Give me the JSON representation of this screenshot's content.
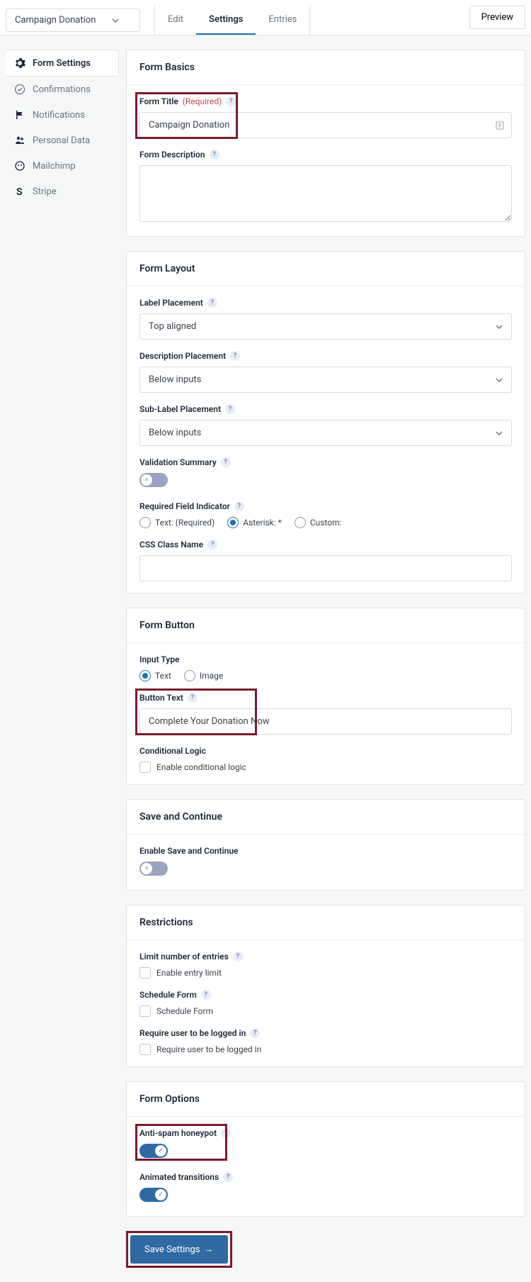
{
  "header": {
    "formSelector": "Campaign Donation",
    "tabs": {
      "edit": "Edit",
      "settings": "Settings",
      "entries": "Entries"
    },
    "preview": "Preview"
  },
  "sidebar": {
    "items": [
      {
        "label": "Form Settings"
      },
      {
        "label": "Confirmations"
      },
      {
        "label": "Notifications"
      },
      {
        "label": "Personal Data"
      },
      {
        "label": "Mailchimp"
      },
      {
        "label": "Stripe"
      }
    ]
  },
  "basics": {
    "heading": "Form Basics",
    "titleLabel": "Form Title",
    "titleReq": "(Required)",
    "titleValue": "Campaign Donation",
    "descLabel": "Form Description",
    "descValue": ""
  },
  "layout": {
    "heading": "Form Layout",
    "labelPlacement": {
      "label": "Label Placement",
      "value": "Top aligned"
    },
    "descPlacement": {
      "label": "Description Placement",
      "value": "Below inputs"
    },
    "subLabelPlacement": {
      "label": "Sub-Label Placement",
      "value": "Below inputs"
    },
    "validation": {
      "label": "Validation Summary"
    },
    "reqIndicator": {
      "label": "Required Field Indicator",
      "opt1": "Text: (Required)",
      "opt2": "Asterisk: *",
      "opt3": "Custom:"
    },
    "cssClass": {
      "label": "CSS Class Name",
      "value": ""
    }
  },
  "button": {
    "heading": "Form Button",
    "inputTypeLabel": "Input Type",
    "typeText": "Text",
    "typeImage": "Image",
    "buttonTextLabel": "Button Text",
    "buttonTextValue": "Complete Your Donation Now",
    "condLabel": "Conditional Logic",
    "condCheckbox": "Enable conditional logic"
  },
  "saveContinue": {
    "heading": "Save and Continue",
    "enableLabel": "Enable Save and Continue"
  },
  "restrictions": {
    "heading": "Restrictions",
    "limitLabel": "Limit number of entries",
    "limitCheckbox": "Enable entry limit",
    "scheduleLabel": "Schedule Form",
    "scheduleCheckbox": "Schedule Form",
    "loginLabel": "Require user to be logged in",
    "loginCheckbox": "Require user to be logged in"
  },
  "options": {
    "heading": "Form Options",
    "antiSpamLabel": "Anti-spam honeypot",
    "animLabel": "Animated transitions"
  },
  "saveButton": "Save Settings"
}
